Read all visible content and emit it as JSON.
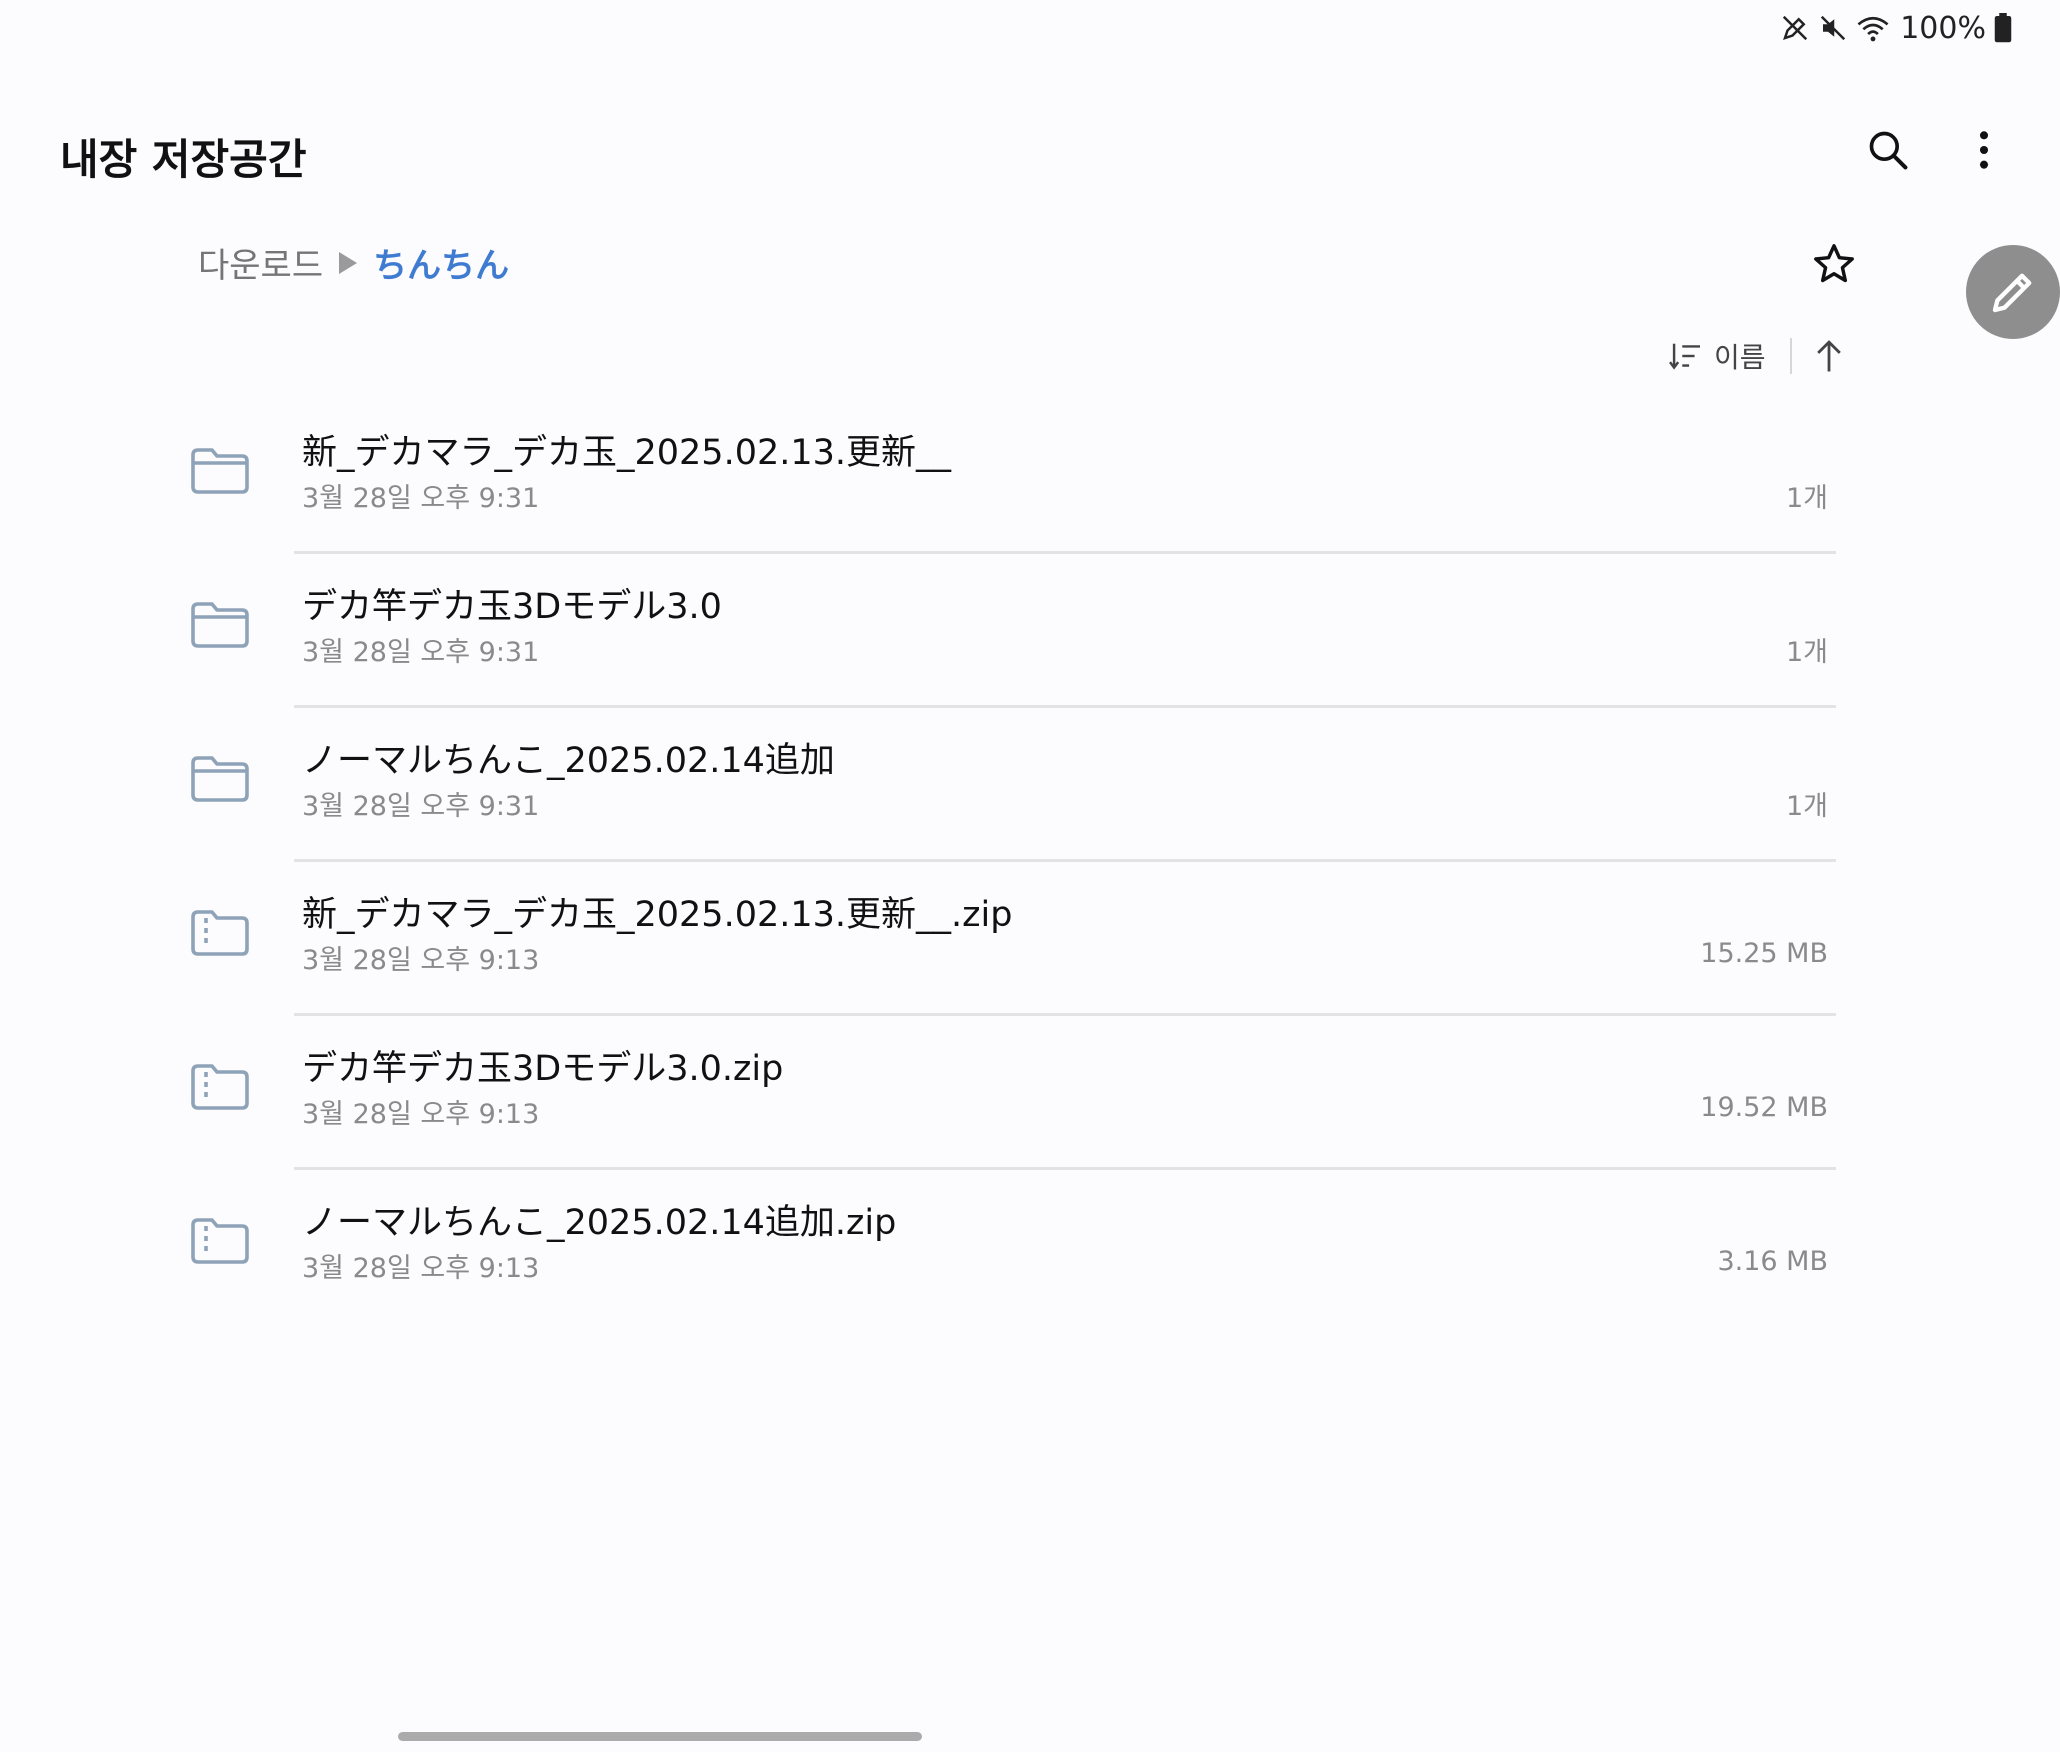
{
  "status_bar": {
    "battery": "100%",
    "icons": [
      "stylus-icon",
      "mute-icon",
      "wifi-icon",
      "battery-icon"
    ]
  },
  "header": {
    "title": "내장 저장공간",
    "icons": [
      "search-icon",
      "more-vert-icon"
    ]
  },
  "breadcrumb": {
    "parent": "다운로드",
    "current": "ちんちん"
  },
  "sort": {
    "label": "이름",
    "order": "ascending"
  },
  "colors": {
    "accent": "#3e7bd1",
    "folder_icon": "#8fa3b8",
    "secondary_text": "#8a8a8a",
    "fab": "#8e8e8e"
  },
  "files": [
    {
      "name": "新_デカマラ_デカ玉_2025.02.13.更新__",
      "date": "3월 28일 오후 9:31",
      "size": "1개",
      "type": "folder"
    },
    {
      "name": "デカ竿デカ玉3Dモデル3.0",
      "date": "3월 28일 오후 9:31",
      "size": "1개",
      "type": "folder"
    },
    {
      "name": "ノーマルちんこ_2025.02.14追加",
      "date": "3월 28일 오후 9:31",
      "size": "1개",
      "type": "folder"
    },
    {
      "name": "新_デカマラ_デカ玉_2025.02.13.更新__.zip",
      "date": "3월 28일 오후 9:13",
      "size": "15.25 MB",
      "type": "zip"
    },
    {
      "name": "デカ竿デカ玉3Dモデル3.0.zip",
      "date": "3월 28일 오후 9:13",
      "size": "19.52 MB",
      "type": "zip"
    },
    {
      "name": "ノーマルちんこ_2025.02.14追加.zip",
      "date": "3월 28일 오후 9:13",
      "size": "3.16 MB",
      "type": "zip"
    }
  ]
}
